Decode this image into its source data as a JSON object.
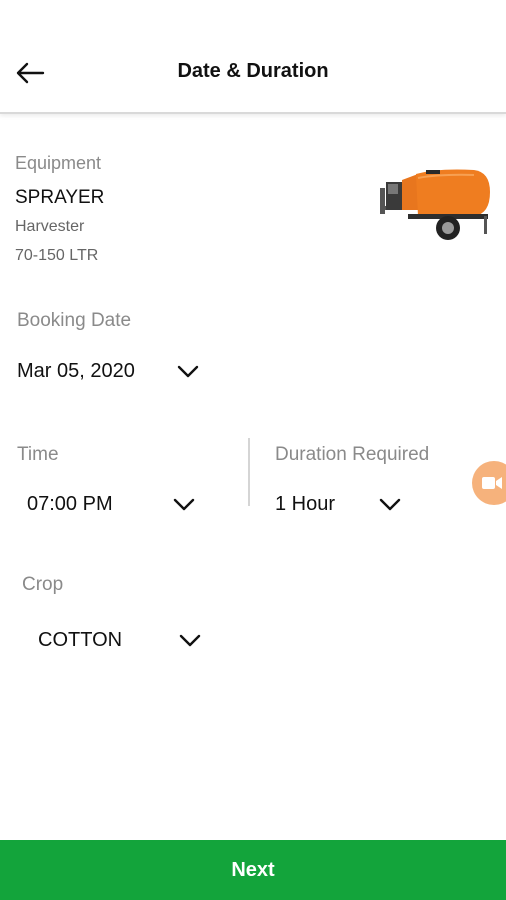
{
  "header": {
    "title": "Date & Duration"
  },
  "equipment": {
    "label": "Equipment",
    "name": "SPRAYER",
    "type": "Harvester",
    "capacity": "70-150 LTR"
  },
  "booking_date": {
    "label": "Booking Date",
    "value": "Mar 05, 2020"
  },
  "time": {
    "label": "Time",
    "value": "07:00 PM"
  },
  "duration": {
    "label": "Duration Required",
    "value": "1 Hour"
  },
  "crop": {
    "label": "Crop",
    "value": "COTTON"
  },
  "footer": {
    "next_label": "Next"
  },
  "colors": {
    "accent_green": "#13a43b",
    "fab_orange": "#f6b27c",
    "equipment_orange": "#e8761e"
  },
  "icons": [
    "arrow-left-icon",
    "chevron-down-icon",
    "video-icon"
  ]
}
